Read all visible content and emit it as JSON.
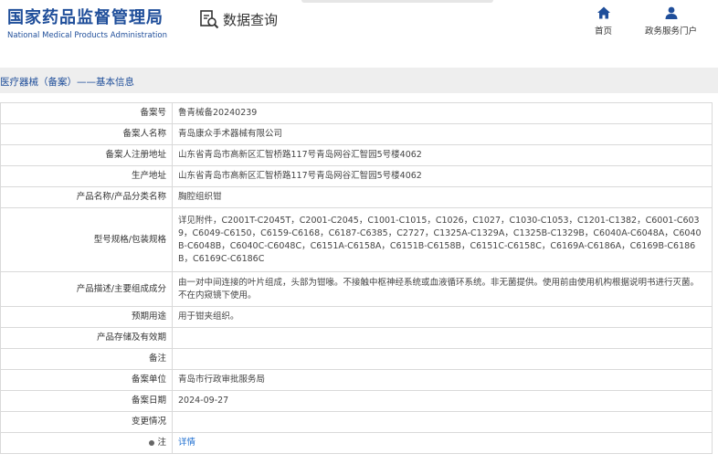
{
  "header": {
    "logo_cn": "国家药品监督管理局",
    "logo_en": "National Medical Products Administration",
    "query_title": "数据查询",
    "nav": [
      {
        "label": "首页",
        "icon": "home-icon"
      },
      {
        "label": "政务服务门户",
        "icon": "user-icon"
      }
    ],
    "brand_color": "#1f4e9a"
  },
  "breadcrumb": "医疗器械（备案）——基本信息",
  "rows": [
    {
      "label": "备案号",
      "value": "鲁青械备20240239"
    },
    {
      "label": "备案人名称",
      "value": "青岛康众手术器械有限公司"
    },
    {
      "label": "备案人注册地址",
      "value": "山东省青岛市高新区汇智桥路117号青岛网谷汇智园5号楼4062"
    },
    {
      "label": "生产地址",
      "value": "山东省青岛市高新区汇智桥路117号青岛网谷汇智园5号楼4062"
    },
    {
      "label": "产品名称/产品分类名称",
      "value": "胸腔组织钳"
    },
    {
      "label": "型号规格/包装规格",
      "value": "详见附件，C2001T-C2045T，C2001-C2045，C1001-C1015，C1026，C1027，C1030-C1053，C1201-C1382，C6001-C6039，C6049-C6150，C6159-C6168，C6187-C6385，C2727，C1325A-C1329A，C1325B-C1329B，C6040A-C6048A，C6040B-C6048B，C6040C-C6048C，C6151A-C6158A，C6151B-C6158B，C6151C-C6158C，C6169A-C6186A，C6169B-C6186B，C6169C-C6186C"
    },
    {
      "label": "产品描述/主要组成成分",
      "value": "由一对中间连接的叶片组成，头部为钳喙。不接触中枢神经系统或血液循环系统。非无菌提供。使用前由使用机构根据说明书进行灭菌。不在内窥镜下使用。"
    },
    {
      "label": "预期用途",
      "value": "用于钳夹组织。"
    },
    {
      "label": "产品存储及有效期",
      "value": ""
    },
    {
      "label": "备注",
      "value": ""
    },
    {
      "label": "备案单位",
      "value": "青岛市行政审批服务局"
    },
    {
      "label": "备案日期",
      "value": "2024-09-27"
    },
    {
      "label": "变更情况",
      "value": ""
    }
  ],
  "note": {
    "label": "注",
    "link": "详情"
  }
}
